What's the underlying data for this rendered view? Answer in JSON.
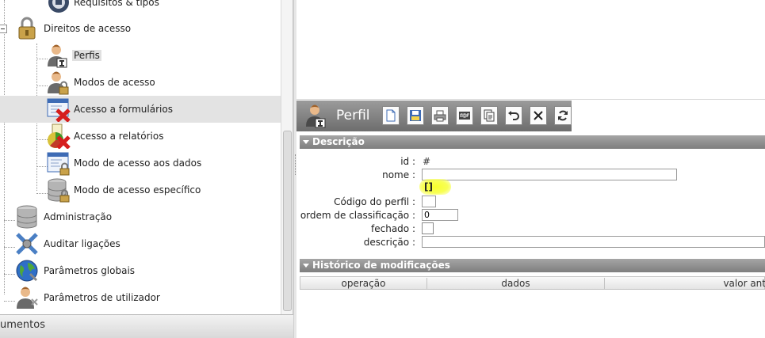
{
  "tree": {
    "items": [
      {
        "label": "Requisitos & tipos",
        "icon": "key-icon"
      },
      {
        "label": "Direitos de acesso",
        "icon": "padlock-icon"
      },
      {
        "label": "Perfis",
        "icon": "user-profile-icon"
      },
      {
        "label": "Modos de acesso",
        "icon": "user-lock-icon"
      },
      {
        "label": "Acesso a formulários",
        "icon": "form-denied-icon"
      },
      {
        "label": "Acesso a relatórios",
        "icon": "report-denied-icon"
      },
      {
        "label": "Modo de acesso aos dados",
        "icon": "data-window-lock-icon"
      },
      {
        "label": "Modo de acesso específico",
        "icon": "database-lock-icon"
      },
      {
        "label": "Administração",
        "icon": "database-icon"
      },
      {
        "label": "Auditar ligações",
        "icon": "audit-connections-icon"
      },
      {
        "label": "Parâmetros globais",
        "icon": "globe-icon"
      },
      {
        "label": "Parâmetros de utilizador",
        "icon": "user-settings-icon"
      }
    ]
  },
  "accordion": {
    "label": "umentos"
  },
  "form": {
    "title": "Perfil",
    "toolbar": [
      "new-document-icon",
      "save-icon",
      "print-icon",
      "pdf-icon",
      "copy-icon",
      "undo-icon",
      "delete-icon",
      "refresh-icon"
    ],
    "section_description": "Descrição",
    "fields": {
      "id_label": "id :",
      "id_value": "#",
      "nome_label": "nome :",
      "nome_value": "",
      "brackets": "[]",
      "codigo_label": "Código do perfil :",
      "codigo_value": "",
      "ordem_label": "ordem de classificação :",
      "ordem_value": "0",
      "fechado_label": "fechado :",
      "descricao_label": "descrição :",
      "descricao_value": ""
    },
    "section_history": "Histórico de modificações",
    "history_columns": [
      "operação",
      "dados",
      "valor ant"
    ]
  },
  "colors": {
    "selected_row": "#e3e3e3",
    "section_header": "#8e8e8e",
    "highlight": "#f7ff2e"
  }
}
